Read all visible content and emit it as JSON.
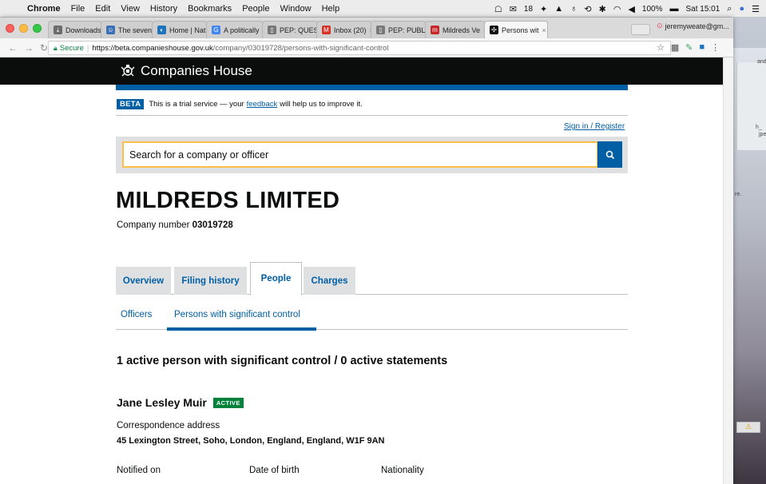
{
  "menubar": {
    "app": "Chrome",
    "menus": [
      "File",
      "Edit",
      "View",
      "History",
      "Bookmarks",
      "People",
      "Window",
      "Help"
    ],
    "status": {
      "count": "18",
      "battery": "100%",
      "clock": "Sat 15:01"
    }
  },
  "browser": {
    "tabs": [
      {
        "label": "Downloads",
        "icon": "download-icon",
        "color": "#6b6b6b"
      },
      {
        "label": "The seven",
        "icon": "people-icon",
        "color": "#3b6fb6"
      },
      {
        "label": "Home | Nat",
        "icon": "nav-icon",
        "color": "#1e73be"
      },
      {
        "label": "A politically",
        "icon": "google-icon",
        "color": "#4285f4"
      },
      {
        "label": "PEP: QUES",
        "icon": "document-icon",
        "color": "#777777"
      },
      {
        "label": "Inbox (20)",
        "icon": "gmail-icon",
        "color": "#d93025"
      },
      {
        "label": "PEP: PUBLI",
        "icon": "document-icon",
        "color": "#777777"
      },
      {
        "label": "Mildreds Ve",
        "icon": "m-icon",
        "color": "#c62828"
      },
      {
        "label": "Persons wit",
        "icon": "companies-house-icon",
        "color": "#0b0c0c"
      }
    ],
    "user": "jeremyweate@gm...",
    "url": {
      "secure_label": "Secure",
      "host": "https://beta.companieshouse.gov.uk",
      "path": "/company/03019728/persons-with-significant-control"
    }
  },
  "site": {
    "brand": "Companies House",
    "beta": {
      "tag": "BETA",
      "text_before": "This is a trial service — your",
      "link": "feedback",
      "text_after": "will help us to improve it."
    },
    "signin": "Sign in / Register",
    "search": {
      "placeholder": "Search for a company or officer"
    },
    "company": {
      "name": "MILDREDS LIMITED",
      "number_label": "Company number",
      "number": "03019728"
    },
    "tabs": [
      "Overview",
      "Filing history",
      "People",
      "Charges"
    ],
    "active_tab": "People",
    "subtabs": [
      "Officers",
      "Persons with significant control"
    ],
    "active_subtab": "Persons with significant control",
    "psc_heading": "1 active person with significant control / 0 active statements",
    "person": {
      "name": "Jane Lesley Muir",
      "status": "ACTIVE",
      "address_label": "Correspondence address",
      "address": "45 Lexington Street, Soho, London, England, England, W1F 9AN",
      "fields": [
        "Notified on",
        "Date of birth",
        "Nationality"
      ]
    }
  },
  "desktop": {
    "labels": [
      "and",
      "h_",
      "jpe",
      "re."
    ]
  },
  "colors": {
    "gov_blue": "#005ea5",
    "black": "#0b0c0c",
    "yellow_focus": "#ffbf47",
    "active_green": "#00823b",
    "grey_tab": "#dee0e2"
  }
}
